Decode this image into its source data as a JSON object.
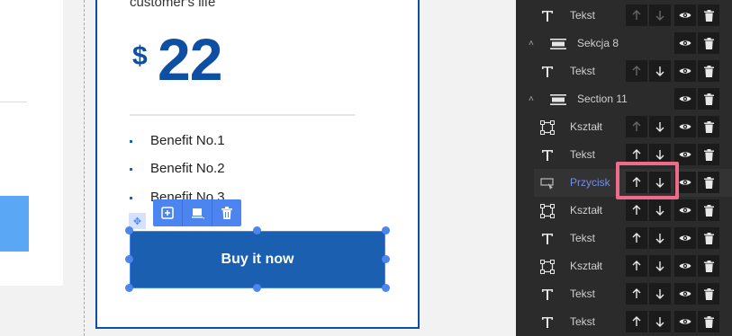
{
  "card": {
    "top_text": "customer's life",
    "currency": "$",
    "price": "22",
    "benefits": [
      "Benefit No.1",
      "Benefit No.2",
      "Benefit No.3"
    ],
    "button_label": "Buy it now"
  },
  "toolbar": {
    "icons": [
      "duplicate-icon",
      "layers-icon",
      "trash-icon"
    ],
    "move_icon": "move-icon"
  },
  "layers": [
    {
      "label": "Tekst",
      "type": "text",
      "indent": 1
    },
    {
      "label": "Sekcja 8",
      "type": "section",
      "indent": 0
    },
    {
      "label": "Tekst",
      "type": "text",
      "indent": 1
    },
    {
      "label": "Section 11",
      "type": "section",
      "indent": 0
    },
    {
      "label": "Kształt",
      "type": "shape",
      "indent": 1
    },
    {
      "label": "Tekst",
      "type": "text",
      "indent": 1
    },
    {
      "label": "Przycisk",
      "type": "button",
      "indent": 1,
      "selected": true
    },
    {
      "label": "Kształt",
      "type": "shape",
      "indent": 1
    },
    {
      "label": "Tekst",
      "type": "text",
      "indent": 1
    },
    {
      "label": "Kształt",
      "type": "shape",
      "indent": 1
    },
    {
      "label": "Tekst",
      "type": "text",
      "indent": 1
    },
    {
      "label": "Tekst",
      "type": "text",
      "indent": 1
    }
  ],
  "colors": {
    "accent": "#4c84f0",
    "brand_blue": "#0d4fa3",
    "highlight": "#ef6b8a",
    "panel_bg": "#2b2b2b"
  }
}
